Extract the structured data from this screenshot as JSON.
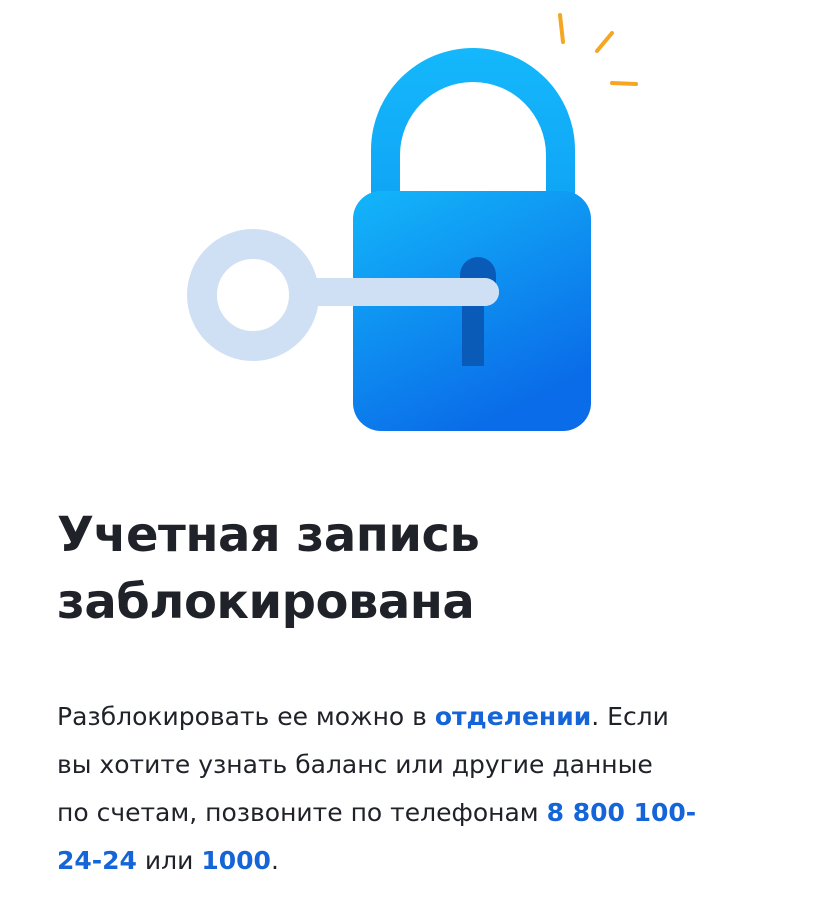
{
  "illustration": {
    "icon": "padlock-with-key-icon",
    "lock_gradient_top": "#12b4f9",
    "lock_gradient_bottom": "#0a6ee8",
    "key_color": "#cfe0f5",
    "sparkle_color": "#f5a623",
    "keyhole_color": "#0a5bb8"
  },
  "title": {
    "line1": "Учетная запись",
    "line2": "заблокирована"
  },
  "description": {
    "part1": "Разблокировать ее можно в ",
    "branch_link": "отделении",
    "part2": ". Если",
    "line2": "вы хотите узнать баланс или другие данные",
    "part3": "по счетам, позвоните по телефонам ",
    "phone1_line1": "8 800 100-",
    "phone1_line2": "24-24",
    "part4": " или ",
    "phone2": "1000",
    "part5": "."
  },
  "colors": {
    "text": "#1f2229",
    "link": "#1565d8"
  }
}
